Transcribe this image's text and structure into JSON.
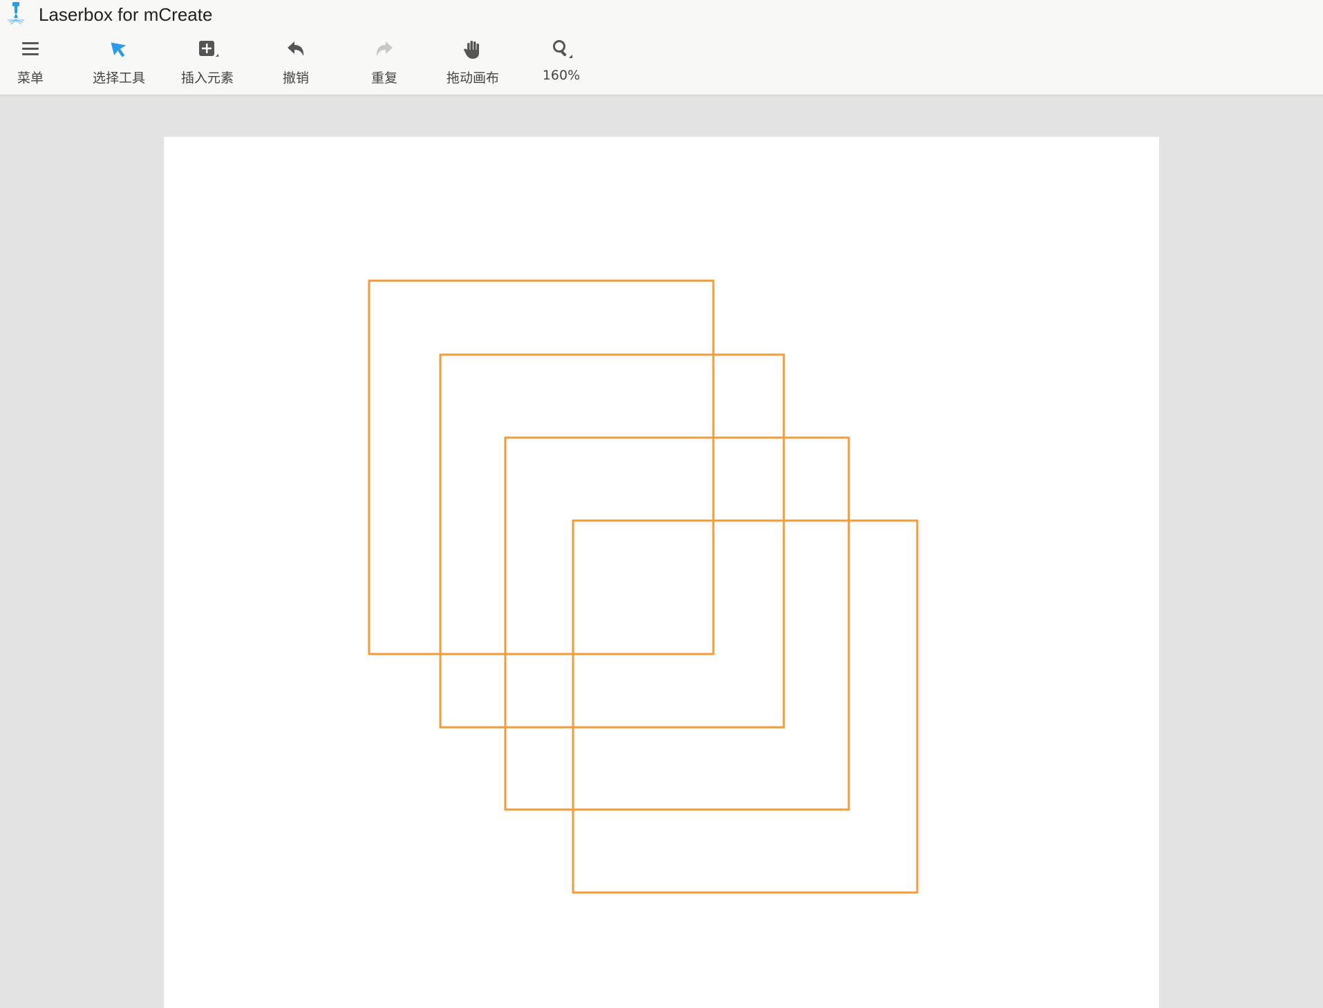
{
  "window": {
    "title": "Laserbox for mCreate",
    "logo_icon": "laser-head-icon"
  },
  "toolbar": {
    "items": [
      {
        "id": "menu",
        "label": "菜单",
        "icon": "hamburger-menu-icon",
        "color": "#555555"
      },
      {
        "id": "select",
        "label": "选择工具",
        "icon": "pointer-arrow-icon",
        "color": "#2a9bea"
      },
      {
        "id": "insert",
        "label": "插入元素",
        "icon": "add-square-icon",
        "color": "#555555"
      },
      {
        "id": "undo",
        "label": "撤销",
        "icon": "undo-arrow-icon",
        "color": "#555555"
      },
      {
        "id": "redo",
        "label": "重复",
        "icon": "redo-arrow-icon",
        "color": "#c8c8c8"
      },
      {
        "id": "pan",
        "label": "拖动画布",
        "icon": "hand-icon",
        "color": "#555555"
      },
      {
        "id": "zoom",
        "label": "160%",
        "icon": "zoom-magnifier-icon",
        "color": "#555555"
      }
    ]
  },
  "canvas": {
    "background": "#ffffff",
    "stroke_color": "#f39a3a",
    "shape_count": 4,
    "shape_type": "square"
  }
}
